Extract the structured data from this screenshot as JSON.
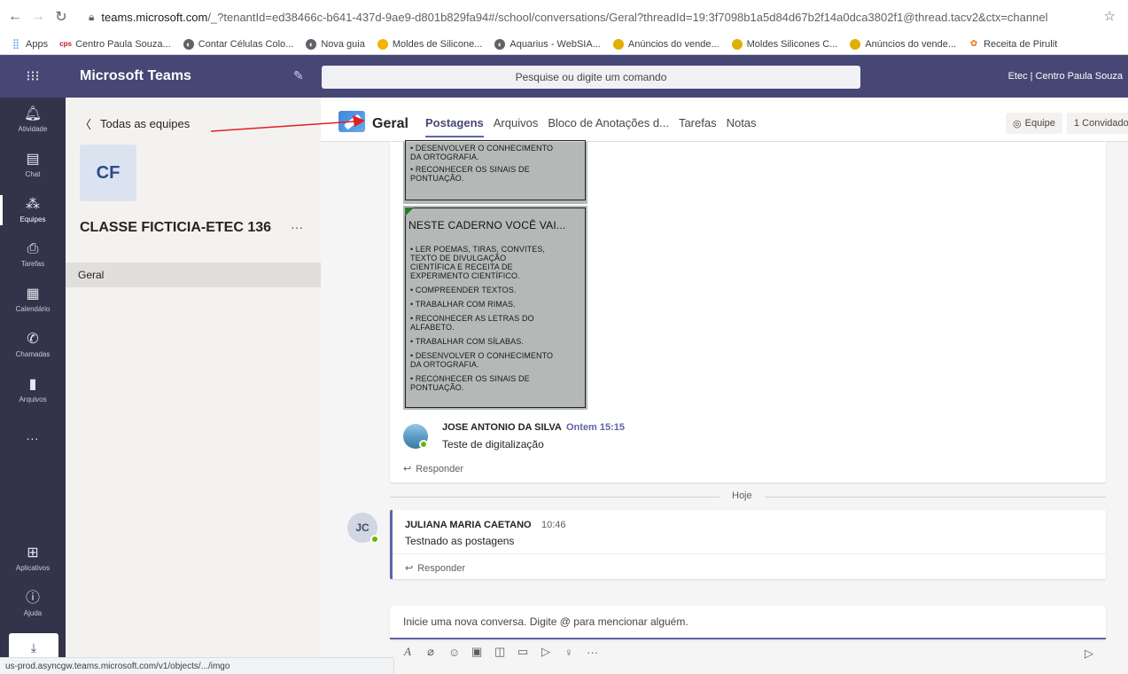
{
  "browser": {
    "url_domain": "teams.microsoft.com",
    "url_rest": "/_?tenantId=ed38466c-b641-437d-9ae9-d801b829fa94#/school/conversations/Geral?threadId=19:3f7098b1a5d84d67b2f14a0dca3802f1@thread.tacv2&ctx=channel",
    "bookmarks": [
      {
        "label": "Apps",
        "icon": "apps-grid-icon",
        "color": "#4285f4"
      },
      {
        "label": "Centro Paula Souza...",
        "icon": "cps-logo-icon",
        "color": "#c8102e"
      },
      {
        "label": "Contar Células Colo...",
        "icon": "globe-icon",
        "color": "#5f6368"
      },
      {
        "label": "Nova guia",
        "icon": "globe-icon",
        "color": "#5f6368"
      },
      {
        "label": "Moldes de Silicone...",
        "icon": "site-icon",
        "color": "#f4b400"
      },
      {
        "label": "Aquarius - WebSIA...",
        "icon": "globe-icon",
        "color": "#5f6368"
      },
      {
        "label": "Anúncios do vende...",
        "icon": "handshake-icon",
        "color": "#e0b000"
      },
      {
        "label": "Moldes Silicones C...",
        "icon": "handshake-icon",
        "color": "#e0b000"
      },
      {
        "label": "Anúncios do vende...",
        "icon": "handshake-icon",
        "color": "#e0b000"
      },
      {
        "label": "Receita de Pirulit",
        "icon": "recipe-icon",
        "color": "#e8711a"
      }
    ],
    "status_url": "us-prod.asyncgw.teams.microsoft.com/v1/objects/.../imgo"
  },
  "teams": {
    "app_title": "Microsoft Teams",
    "search_placeholder": "Pesquise ou digite um comando",
    "org_name": "Etec | Centro Paula Souza",
    "appbar": [
      {
        "label": "Atividade",
        "icon": "bell-icon"
      },
      {
        "label": "Chat",
        "icon": "chat-icon"
      },
      {
        "label": "Equipes",
        "icon": "teams-icon",
        "active": true
      },
      {
        "label": "Tarefas",
        "icon": "assignments-icon"
      },
      {
        "label": "Calendário",
        "icon": "calendar-icon"
      },
      {
        "label": "Chamadas",
        "icon": "phone-icon"
      },
      {
        "label": "Arquivos",
        "icon": "file-icon"
      },
      {
        "label": "...",
        "icon": "more-icon"
      },
      {
        "label": "Aplicativos",
        "icon": "apps-icon"
      },
      {
        "label": "Ajuda",
        "icon": "help-icon"
      }
    ]
  },
  "team_panel": {
    "back_label": "Todas as equipes",
    "avatar_initials": "CF",
    "team_name": "CLASSE FICTICIA-ETEC 136",
    "more": "···",
    "channels": [
      "Geral"
    ]
  },
  "channel": {
    "name": "Geral",
    "tabs": [
      "Postagens",
      "Arquivos",
      "Bloco de Anotações d...",
      "Tarefas",
      "Notas"
    ],
    "team_button": "Equipe",
    "invite_button": "1 Convidado"
  },
  "scan": {
    "top_lines": [
      "• DESENVOLVER O CONHECIMENTO",
      "   DA ORTOGRAFIA.",
      "• RECONHECER OS SINAIS DE",
      "   PONTUAÇÃO."
    ],
    "title": "NESTE CADERNO VOCÊ VAI...",
    "lines": [
      "• LER POEMAS, TIRAS, CONVITES,",
      "   TEXTO DE DIVULGAÇÃO",
      "   CIENTÍFICA E RECEITA DE",
      "   EXPERIMENTO CIENTÍFICO.",
      "• COMPREENDER TEXTOS.",
      "• TRABALHAR COM RIMAS.",
      "• RECONHECER AS LETRAS DO",
      "   ALFABETO.",
      "• TRABALHAR COM SÍLABAS.",
      "• DESENVOLVER O CONHECIMENTO",
      "   DA ORTOGRAFIA.",
      "• RECONHECER OS SINAIS DE",
      "   PONTUAÇÃO."
    ]
  },
  "messages": [
    {
      "author": "JOSE ANTONIO DA SILVA",
      "time": "Ontem 15:15",
      "text": "Teste de digitalização",
      "reply": "Responder"
    },
    {
      "author": "JULIANA MARIA CAETANO",
      "time": "10:46",
      "text": "Testnado as postagens",
      "reply": "Responder",
      "initials": "JC"
    }
  ],
  "day_divider": "Hoje",
  "compose_placeholder": "Inicie uma nova conversa. Digite @ para mencionar alguém.",
  "compose_tools": [
    {
      "icon": "format-icon",
      "glyph": "A"
    },
    {
      "icon": "attach-icon",
      "glyph": "⌀"
    },
    {
      "icon": "emoji-icon",
      "glyph": "☺"
    },
    {
      "icon": "gif-icon",
      "glyph": "▣"
    },
    {
      "icon": "sticker-icon",
      "glyph": "◫"
    },
    {
      "icon": "meet-now-icon",
      "glyph": "▭"
    },
    {
      "icon": "stream-icon",
      "glyph": "▷"
    },
    {
      "icon": "praise-icon",
      "glyph": "♀"
    },
    {
      "icon": "more-options-icon",
      "glyph": "···"
    }
  ],
  "colors": {
    "brand": "#464775",
    "accent": "#6264a7",
    "presence": "#6bb700",
    "annotation": "#e02020"
  }
}
